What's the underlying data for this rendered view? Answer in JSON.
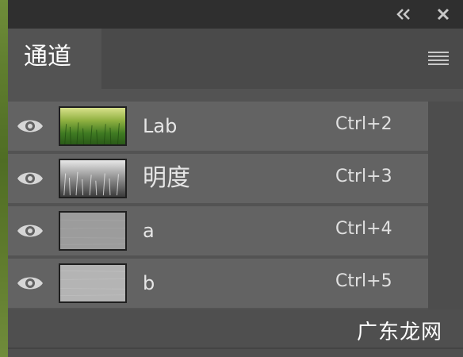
{
  "panel": {
    "tab_label": "通道",
    "icons": {
      "collapse": "double-chevron-left-icon",
      "close": "close-icon",
      "menu": "hamburger-menu-icon",
      "visibility": "eye-icon"
    }
  },
  "channels": [
    {
      "name": "Lab",
      "shortcut": "Ctrl+2",
      "visible": true
    },
    {
      "name": "明度",
      "shortcut": "Ctrl+3",
      "visible": true
    },
    {
      "name": "a",
      "shortcut": "Ctrl+4",
      "visible": true
    },
    {
      "name": "b",
      "shortcut": "Ctrl+5",
      "visible": true
    }
  ],
  "watermark": "广东龙网",
  "colors": {
    "panel_bg": "#535353",
    "row_bg": "#636363",
    "topbar_bg": "#2f2f2f",
    "text": "#e6e6e6"
  }
}
